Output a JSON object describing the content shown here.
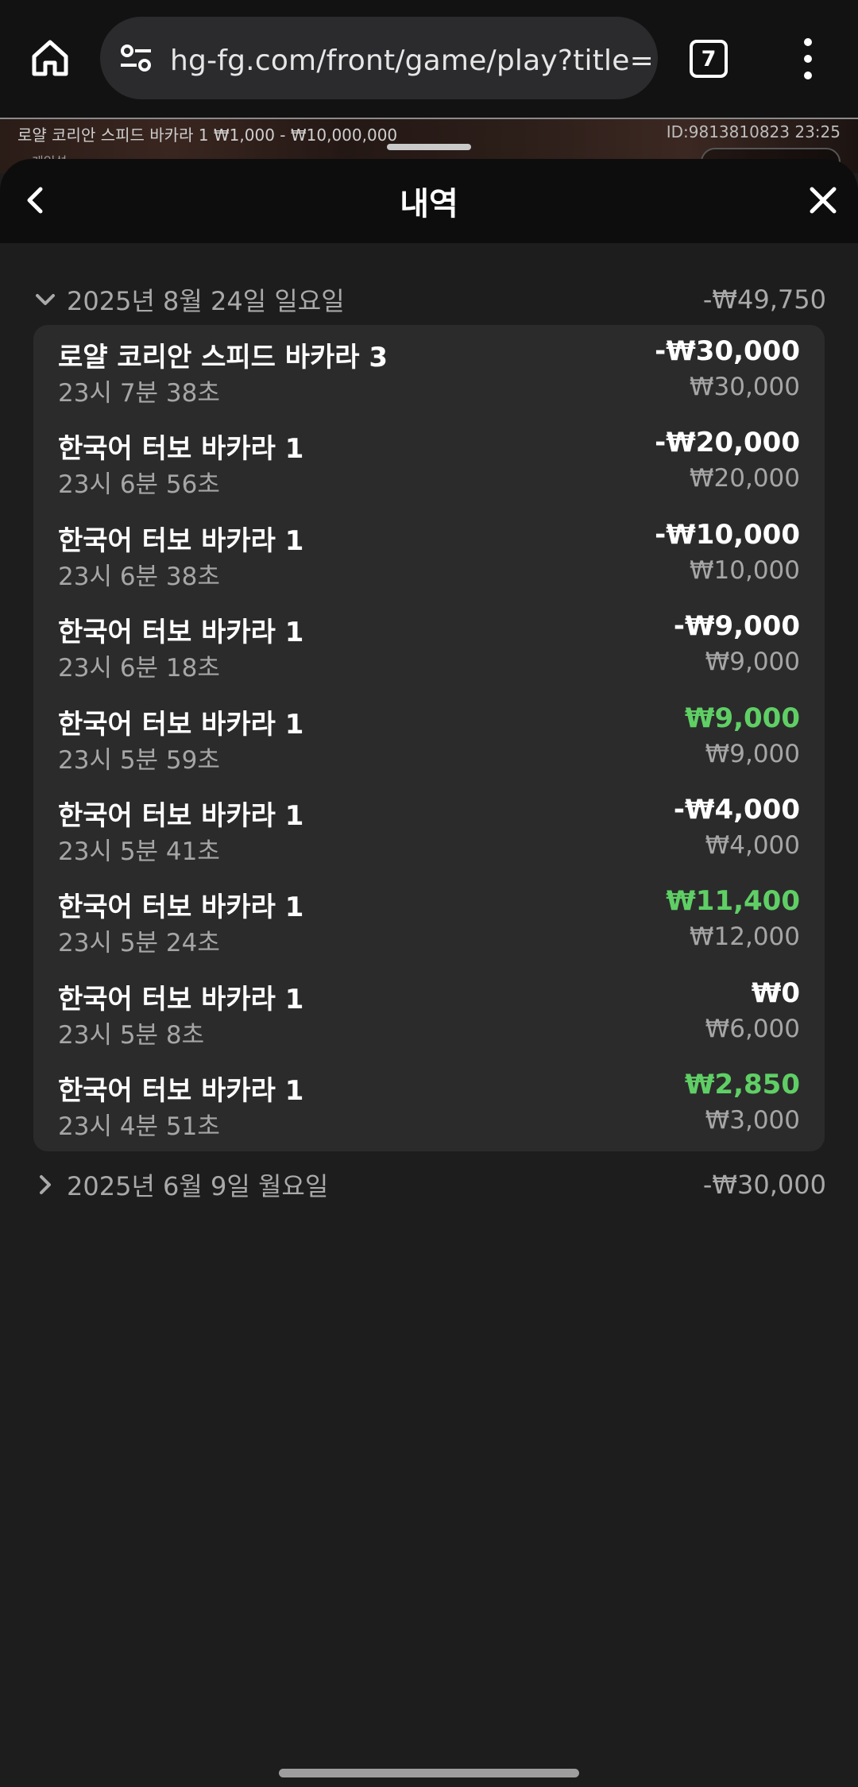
{
  "browser": {
    "url": "hg-fg.com/front/game/play?title=프",
    "tab_count": "7",
    "icons": [
      "home-icon",
      "site-settings-icon",
      "tabs-icon",
      "more-vert-icon"
    ]
  },
  "game_strip": {
    "info_left": "로얄 코리안 스피드 바카라 1  ₩1,000 - ₩10,000,000",
    "info_right": "ID:9813810823  23:25",
    "sub_label": "게임설"
  },
  "sheet": {
    "title": "내역",
    "icons": [
      "back-chevron-icon",
      "close-icon"
    ]
  },
  "groups": [
    {
      "date": "2025년 8월 24일 일요일",
      "total": "-₩49,750",
      "expanded": true,
      "rows": [
        {
          "game": "로얄 코리안 스피드 바카라 3",
          "time": "23시 7분 38초",
          "amount": "-₩30,000",
          "bet": "₩30,000",
          "status": "loss"
        },
        {
          "game": "한국어 터보 바카라 1",
          "time": "23시 6분 56초",
          "amount": "-₩20,000",
          "bet": "₩20,000",
          "status": "loss"
        },
        {
          "game": "한국어 터보 바카라 1",
          "time": "23시 6분 38초",
          "amount": "-₩10,000",
          "bet": "₩10,000",
          "status": "loss"
        },
        {
          "game": "한국어 터보 바카라 1",
          "time": "23시 6분 18초",
          "amount": "-₩9,000",
          "bet": "₩9,000",
          "status": "loss"
        },
        {
          "game": "한국어 터보 바카라 1",
          "time": "23시 5분 59초",
          "amount": "₩9,000",
          "bet": "₩9,000",
          "status": "win"
        },
        {
          "game": "한국어 터보 바카라 1",
          "time": "23시 5분 41초",
          "amount": "-₩4,000",
          "bet": "₩4,000",
          "status": "loss"
        },
        {
          "game": "한국어 터보 바카라 1",
          "time": "23시 5분 24초",
          "amount": "₩11,400",
          "bet": "₩12,000",
          "status": "win"
        },
        {
          "game": "한국어 터보 바카라 1",
          "time": "23시 5분 8초",
          "amount": "₩0",
          "bet": "₩6,000",
          "status": "loss"
        },
        {
          "game": "한국어 터보 바카라 1",
          "time": "23시 4분 51초",
          "amount": "₩2,850",
          "bet": "₩3,000",
          "status": "win"
        }
      ]
    },
    {
      "date": "2025년 6월 9일 월요일",
      "total": "-₩30,000",
      "expanded": false,
      "rows": []
    }
  ],
  "colors": {
    "win": "#5fcf65",
    "loss": "#ffffff",
    "muted": "#a6a6a6",
    "card": "#2b2b2b",
    "background": "#1d1d1d"
  }
}
